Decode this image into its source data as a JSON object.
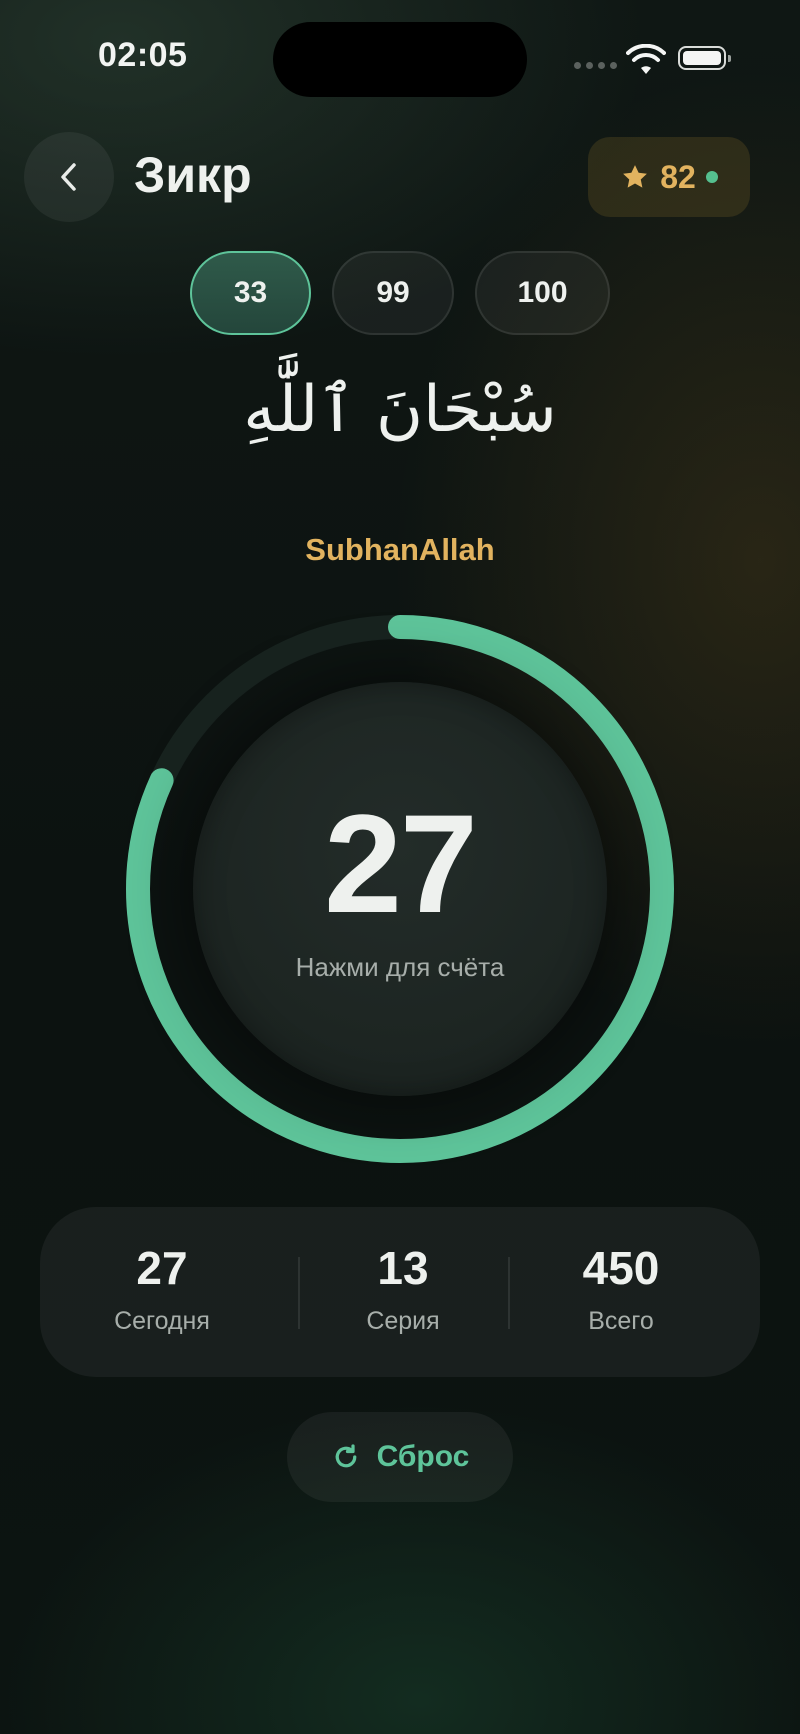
{
  "status_bar": {
    "time": "02:05"
  },
  "header": {
    "title": "Зикр",
    "points": "82"
  },
  "targets": {
    "options": [
      "33",
      "99",
      "100"
    ],
    "selected": "33"
  },
  "dhikr": {
    "arabic": "سُبْحَانَ ٱللَّٰهِ",
    "transliteration": "SubhanAllah"
  },
  "counter": {
    "count": "27",
    "hint": "Нажми для счёта",
    "progress": 0.818
  },
  "stats": [
    {
      "value": "27",
      "label": "Сегодня"
    },
    {
      "value": "13",
      "label": "Серия"
    },
    {
      "value": "450",
      "label": "Всего"
    }
  ],
  "reset": {
    "label": "Сброс"
  },
  "colors": {
    "accent": "#5ec49a",
    "gold": "#e2b35f",
    "background": "#0e1512"
  }
}
